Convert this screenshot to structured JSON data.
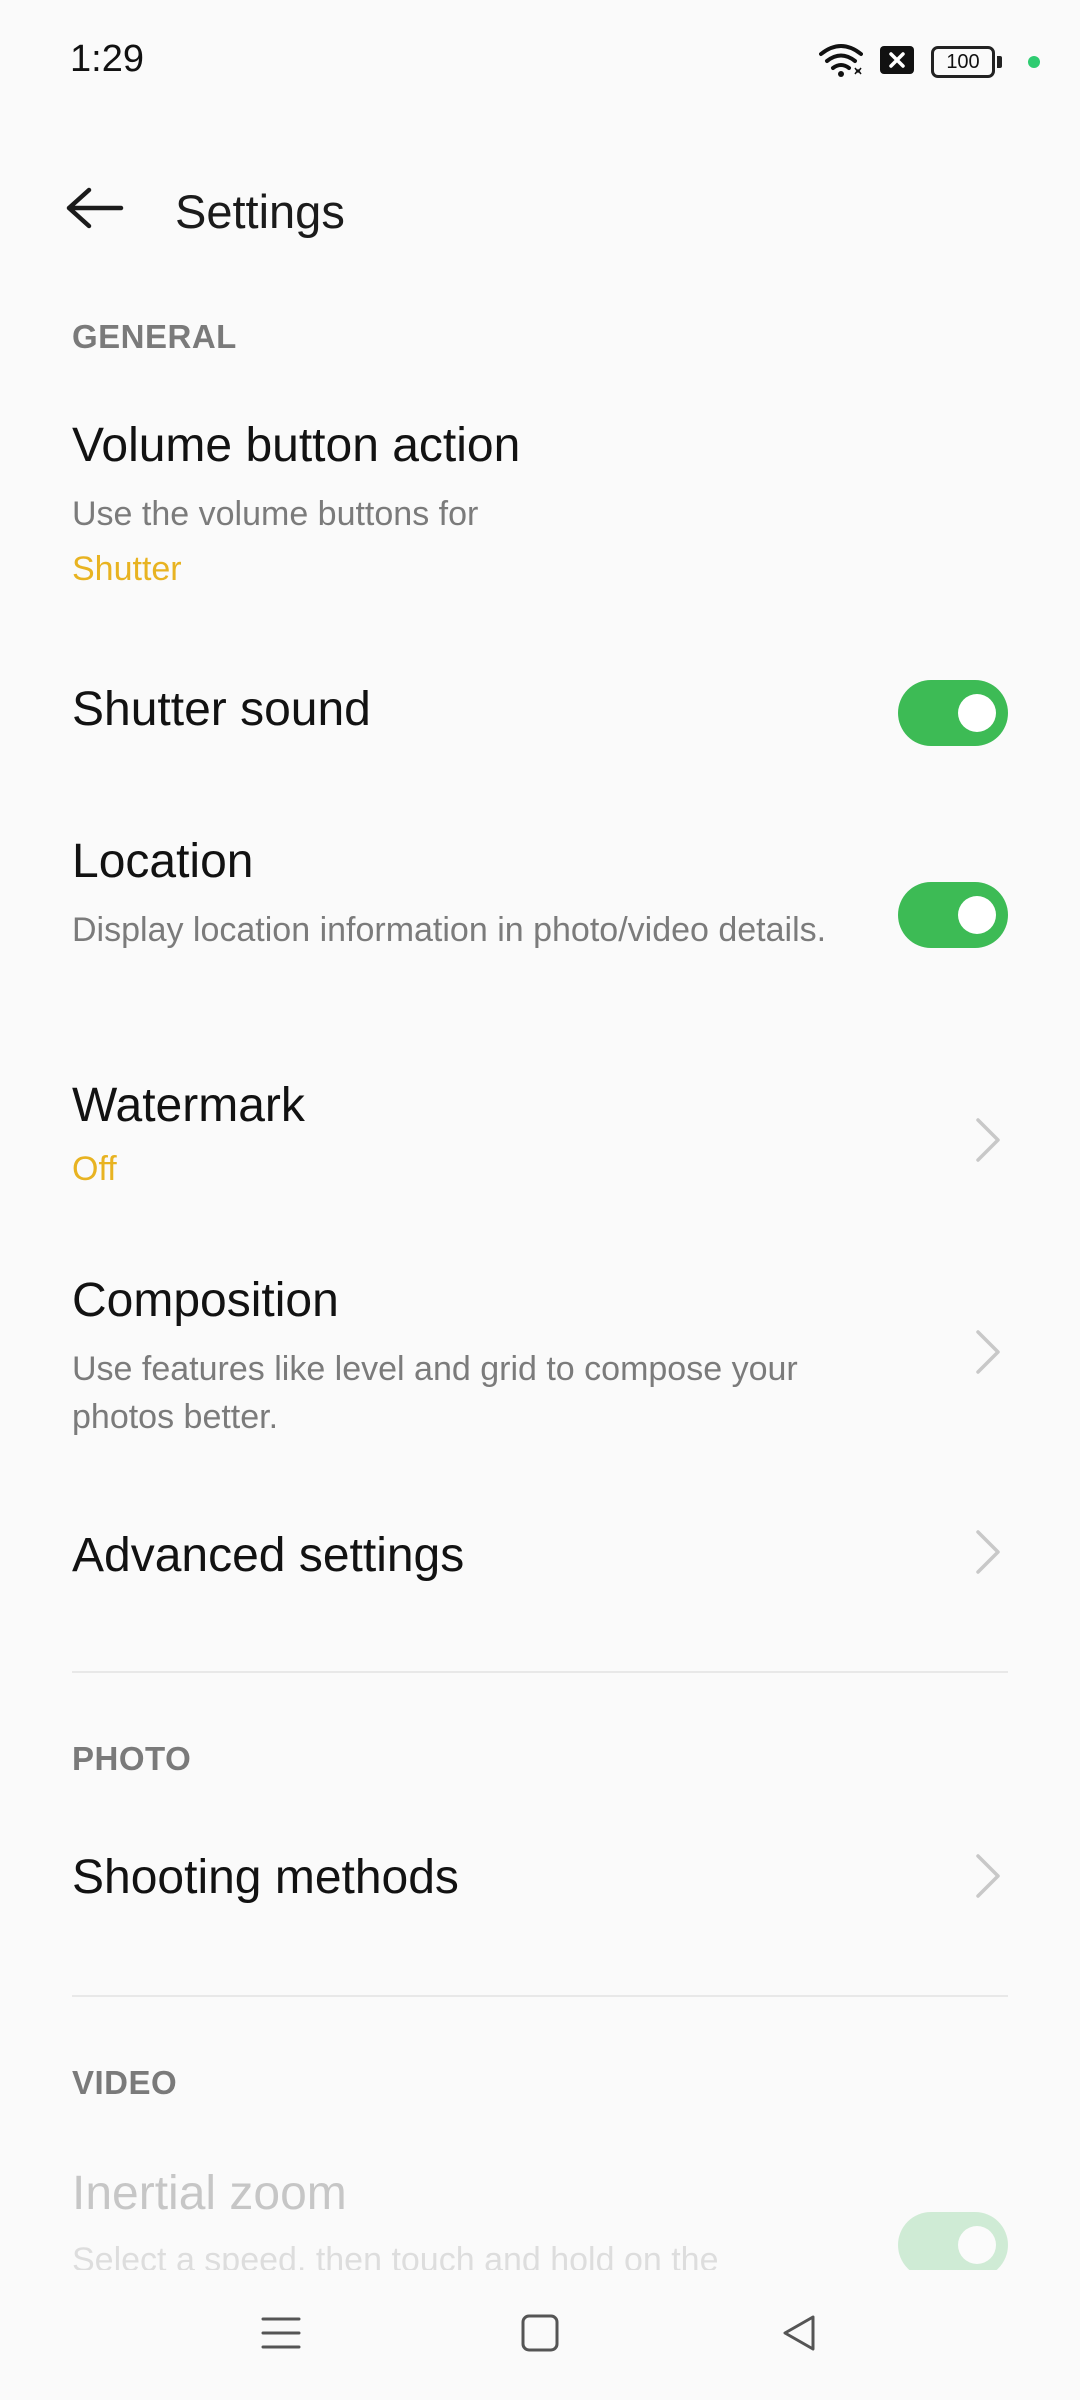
{
  "status_bar": {
    "time": "1:29",
    "battery_level": "100",
    "icons": [
      "wifi-icon",
      "data-off-icon",
      "battery-icon",
      "green-dot-indicator"
    ]
  },
  "header": {
    "back_icon": "arrow-left-icon",
    "title": "Settings"
  },
  "sections": {
    "general": {
      "label": "GENERAL",
      "items": {
        "volume_button_action": {
          "title": "Volume button action",
          "subtitle": "Use the volume buttons for",
          "value": "Shutter"
        },
        "shutter_sound": {
          "title": "Shutter sound",
          "toggle_on": true
        },
        "location": {
          "title": "Location",
          "subtitle": "Display location information in photo/video details.",
          "toggle_on": true
        },
        "watermark": {
          "title": "Watermark",
          "value": "Off"
        },
        "composition": {
          "title": "Composition",
          "subtitle": "Use features like level and grid to compose your photos better."
        },
        "advanced_settings": {
          "title": "Advanced settings"
        }
      }
    },
    "photo": {
      "label": "PHOTO",
      "items": {
        "shooting_methods": {
          "title": "Shooting methods"
        }
      }
    },
    "video": {
      "label": "VIDEO",
      "items": {
        "inertial_zoom": {
          "title": "Inertial zoom",
          "subtitle": "Select a speed, then touch and hold on the",
          "toggle_on": true
        }
      }
    }
  },
  "nav_bar": {
    "buttons": [
      "menu-icon",
      "home-square-icon",
      "back-triangle-icon"
    ]
  },
  "colors": {
    "accent_value": "#e8b321",
    "toggle_on": "#3dbb55",
    "section_label": "#7a7a7a",
    "background": "#fafafa"
  }
}
